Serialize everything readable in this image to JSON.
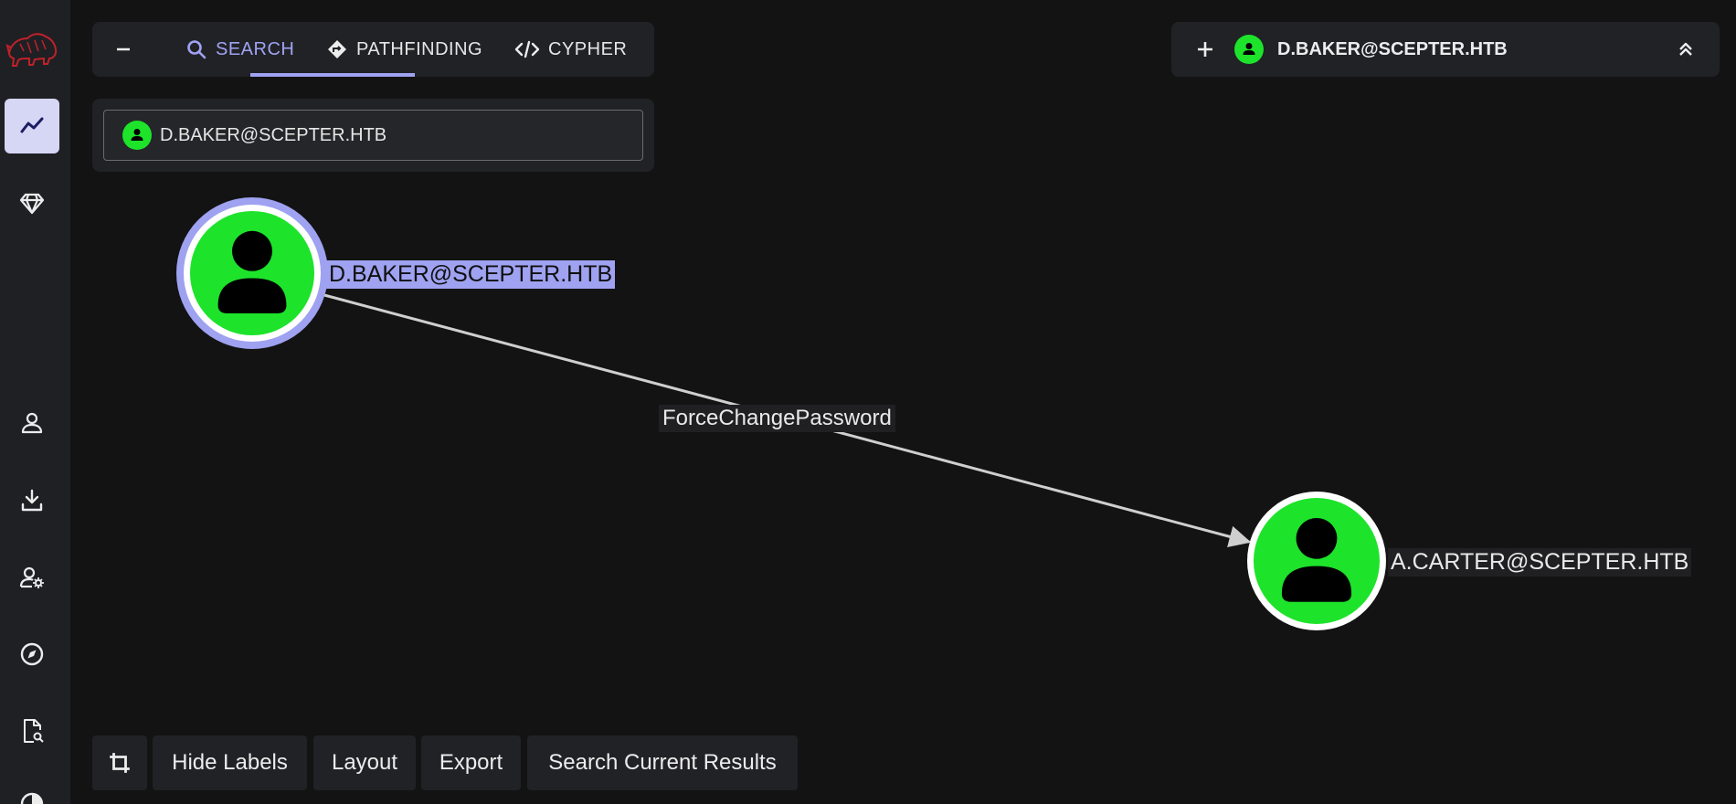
{
  "sidebar": {
    "items": [
      {
        "name": "graph-explore",
        "icon": "trend-line-icon",
        "active": true
      },
      {
        "name": "group-management",
        "icon": "gem-icon",
        "active": false
      },
      {
        "name": "profile",
        "icon": "person-icon",
        "active": false
      },
      {
        "name": "download-collectors",
        "icon": "download-icon",
        "active": false
      },
      {
        "name": "administration",
        "icon": "user-settings-icon",
        "active": false
      },
      {
        "name": "explore",
        "icon": "compass-icon",
        "active": false
      },
      {
        "name": "api-explorer",
        "icon": "file-search-icon",
        "active": false
      },
      {
        "name": "theme",
        "icon": "half-circle-icon",
        "active": false
      }
    ]
  },
  "tabs": {
    "collapse_icon": "minus-icon",
    "items": [
      {
        "label": "SEARCH",
        "icon": "search-icon",
        "active": true
      },
      {
        "label": "PATHFINDING",
        "icon": "directions-icon",
        "active": false
      },
      {
        "label": "CYPHER",
        "icon": "code-icon",
        "active": false
      }
    ]
  },
  "search": {
    "value": "D.BAKER@SCEPTER.HTB",
    "icon": "user-icon"
  },
  "node_panel": {
    "title": "D.BAKER@SCEPTER.HTB",
    "add_icon": "plus-icon",
    "collapse_icon": "double-chevron-up-icon"
  },
  "graph": {
    "nodes": [
      {
        "label": "D.BAKER@SCEPTER.HTB",
        "type": "User",
        "selected": true
      },
      {
        "label": "A.CARTER@SCEPTER.HTB",
        "type": "User",
        "selected": false
      }
    ],
    "edges": [
      {
        "label": "ForceChangePassword",
        "from": "D.BAKER@SCEPTER.HTB",
        "to": "A.CARTER@SCEPTER.HTB"
      }
    ]
  },
  "toolbar": {
    "crop_icon": "crop-icon",
    "hide_labels": "Hide Labels",
    "layout": "Layout",
    "export": "Export",
    "search_results": "Search Current Results"
  },
  "colors": {
    "accent": "#a0a3f2",
    "user_node": "#1de32b",
    "background": "#131314",
    "panel": "#212226"
  }
}
